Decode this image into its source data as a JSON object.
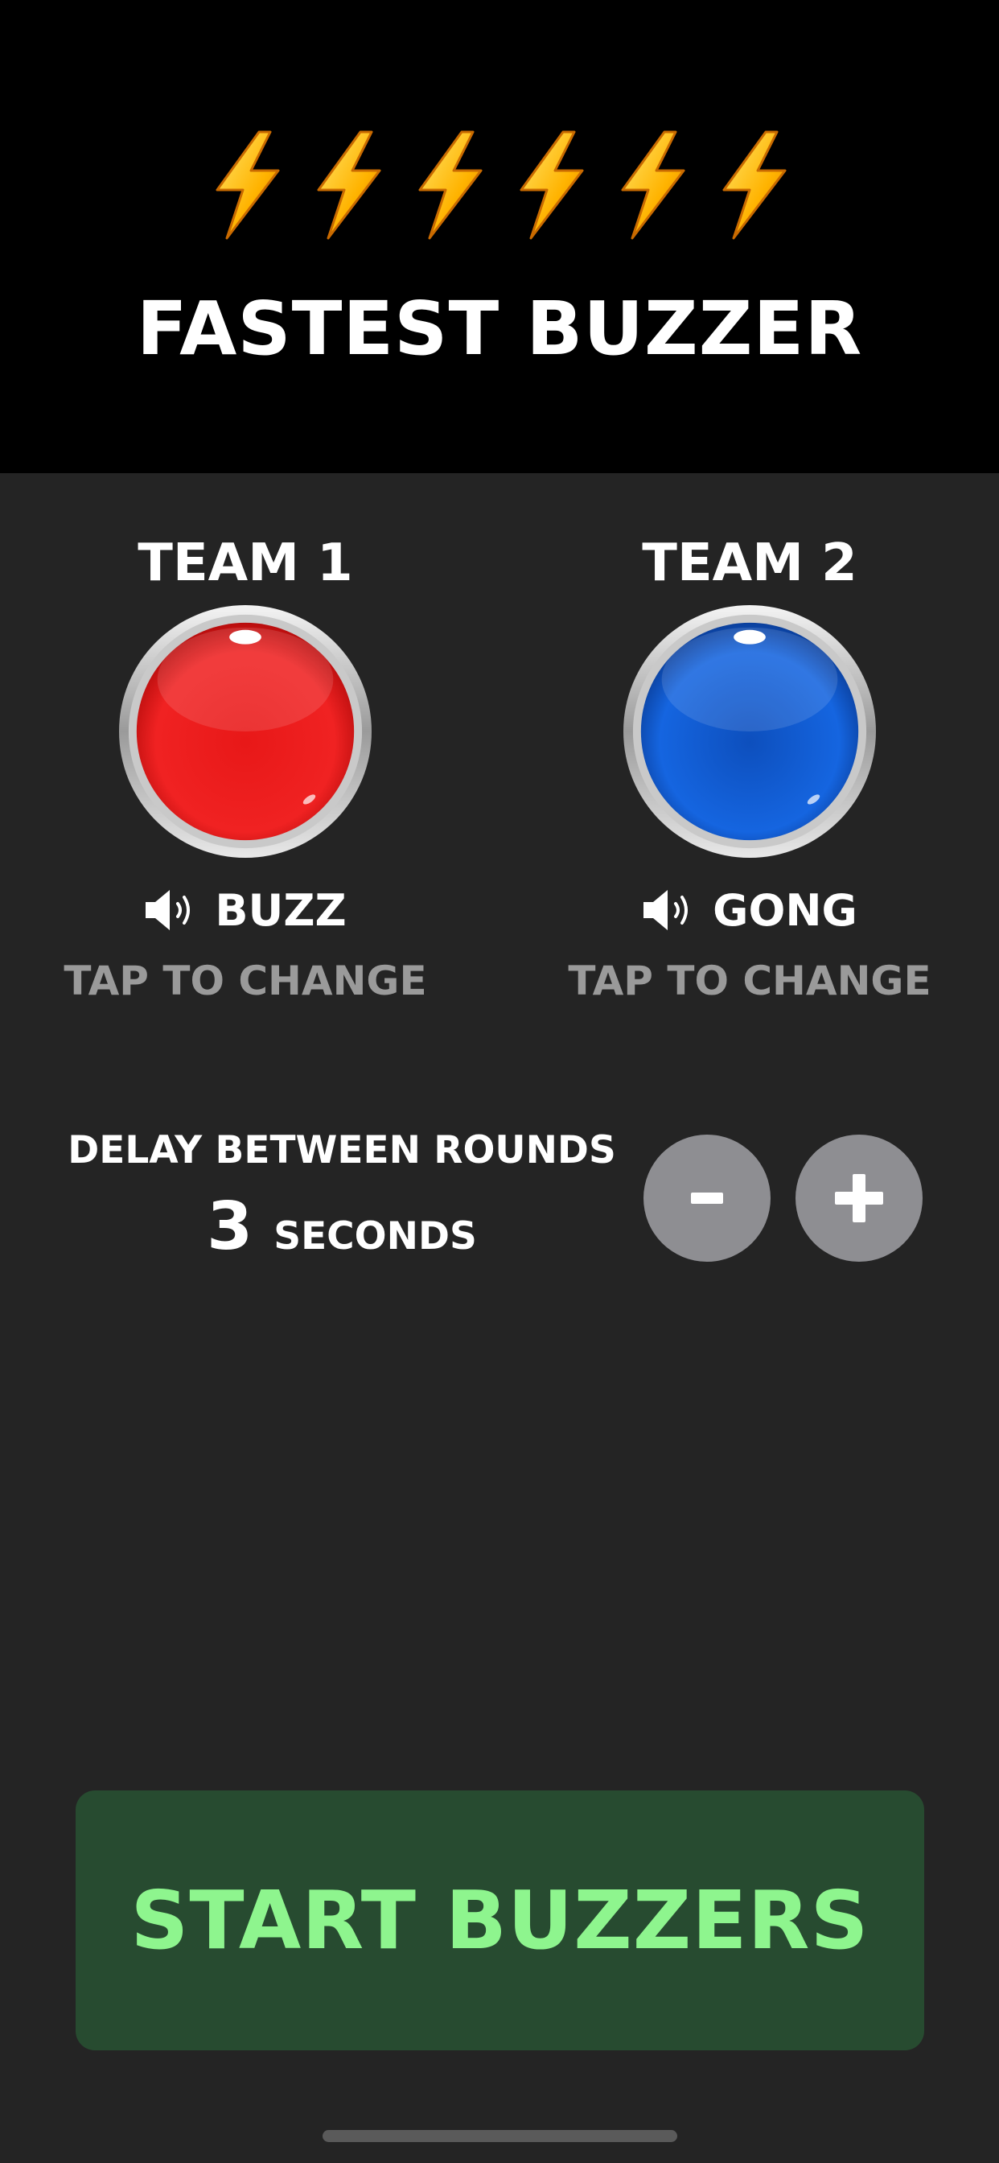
{
  "header": {
    "title": "FASTEST BUZZER",
    "bolt_icon": "lightning-bolt-icon",
    "bolt_count": 6,
    "background": "#000000"
  },
  "teams": [
    {
      "name": "TEAM 1",
      "buzzer_color": "#e81818",
      "sound_icon": "speaker-icon",
      "sound": "BUZZ",
      "change_label": "TAP TO CHANGE"
    },
    {
      "name": "TEAM 2",
      "buzzer_color": "#1261d6",
      "sound_icon": "speaker-icon",
      "sound": "GONG",
      "change_label": "TAP TO CHANGE"
    }
  ],
  "delay": {
    "label": "DELAY BETWEEN ROUNDS",
    "value": "3",
    "unit": "SECONDS",
    "decrement_icon": "minus-icon",
    "increment_icon": "plus-icon"
  },
  "start_button": {
    "label": "START BUZZERS",
    "background": "#274b30",
    "text_color": "#8ef58e"
  }
}
